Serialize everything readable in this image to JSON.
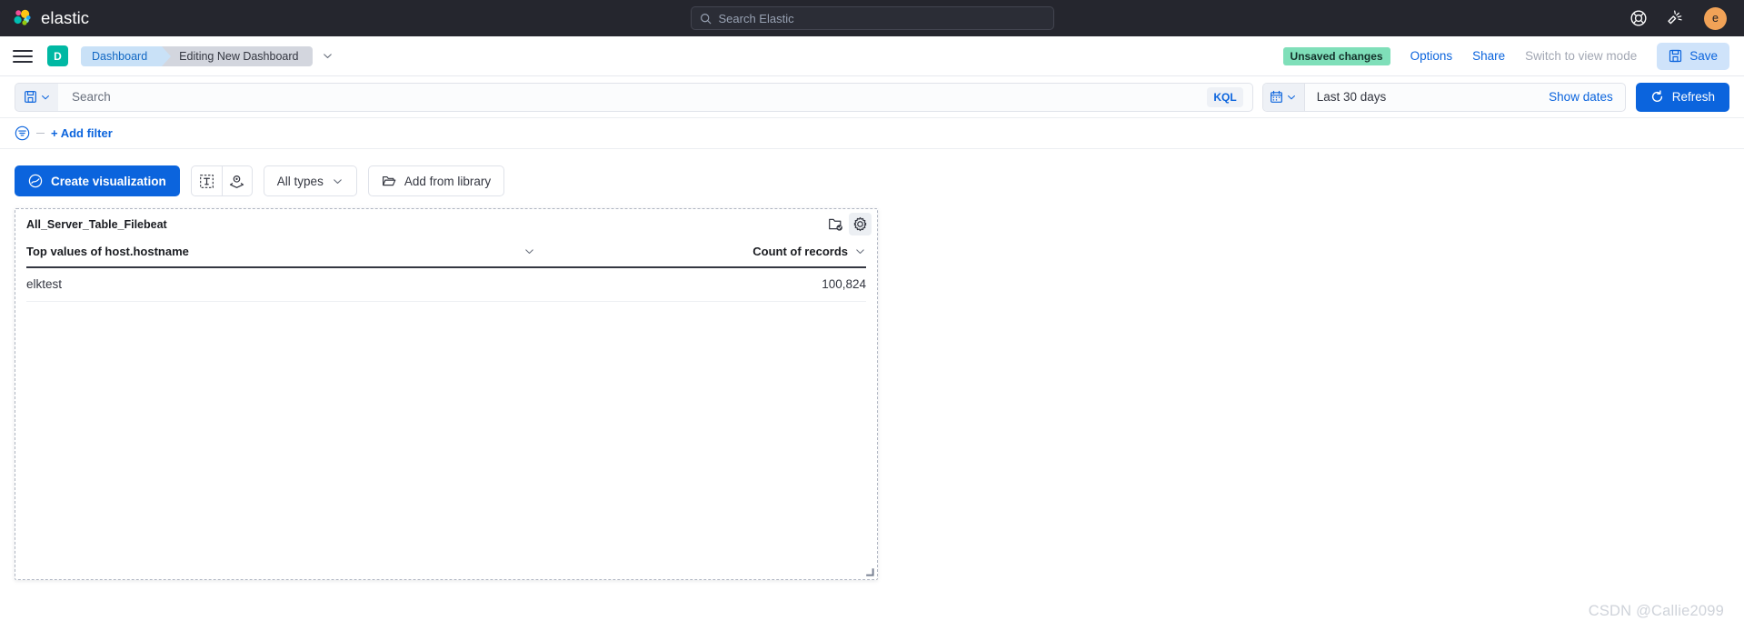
{
  "header": {
    "brand_name": "elastic",
    "brand_logo_icon": "elastic-logo-icon",
    "search": {
      "placeholder": "Search Elastic",
      "value": "",
      "icon": "search-icon"
    },
    "help_icon": "lifebuoy-help-icon",
    "announcements_icon": "megaphone-announcements-icon",
    "avatar_initial": "e",
    "colors": {
      "bar_bg": "#25262e",
      "avatar_bg": "#f1a257"
    }
  },
  "breadcrumb_bar": {
    "menu_icon": "hamburger-menu-icon",
    "space_badge": "D",
    "crumbs": [
      {
        "label": "Dashboard"
      },
      {
        "label": "Editing New Dashboard"
      }
    ],
    "crumb_caret_icon": "chevron-down-icon",
    "unsaved_badge": "Unsaved changes",
    "options_label": "Options",
    "share_label": "Share",
    "view_mode_label": "Switch to view mode",
    "save_label": "Save",
    "save_icon": "save-disk-icon",
    "colors": {
      "unsaved_bg": "#7fdfb9",
      "link": "#0b64dd",
      "space_badge_bg": "#00b8a3"
    }
  },
  "query_bar": {
    "saved_query_icon": "saved-query-disk-icon",
    "saved_query_caret": "chevron-down-icon",
    "search_placeholder": "Search",
    "search_value": "",
    "language_label": "KQL",
    "calendar_icon": "calendar-icon",
    "calendar_caret": "chevron-down-icon",
    "date_range": "Last 30 days",
    "show_dates_label": "Show dates",
    "refresh_label": "Refresh",
    "refresh_icon": "refresh-icon"
  },
  "filter_bar": {
    "filter_icon": "filter-funnel-icon",
    "add_filter_label": "+ Add filter"
  },
  "toolbar": {
    "create_label": "Create visualization",
    "create_icon": "lens-visualize-icon",
    "text_panel_icon": "text-annotation-icon",
    "map_panel_icon": "map-marker-layers-icon",
    "types_label": "All types",
    "types_caret": "chevron-down-icon",
    "library_label": "Add from library",
    "library_icon": "folder-open-icon"
  },
  "panel": {
    "title": "All_Server_Table_Filebeat",
    "library_icon": "folder-check-icon",
    "gear_icon": "gear-settings-icon",
    "resize_icon": "resize-handle-icon",
    "table": {
      "columns": [
        {
          "label": "Top values of host.hostname",
          "align": "left",
          "caret": "chevron-down-icon"
        },
        {
          "label": "Count of records",
          "align": "right",
          "caret": "chevron-down-icon"
        }
      ],
      "rows": [
        {
          "hostname": "elktest",
          "count": "100,824"
        }
      ]
    }
  },
  "watermark": "CSDN @Callie2099"
}
